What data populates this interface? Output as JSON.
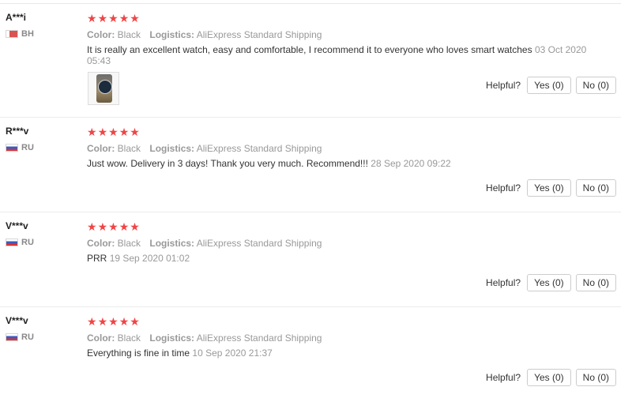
{
  "reviews": [
    {
      "user": "A***i",
      "country": "BH",
      "rating": 5,
      "color_label": "Color:",
      "color_value": "Black",
      "logistics_label": "Logistics:",
      "logistics_value": "AliExpress Standard Shipping",
      "text": "It is really an excellent watch, easy and comfortable, I recommend it to everyone who loves smart watches",
      "date": "03 Oct 2020 05:43",
      "helpful_label": "Helpful?",
      "yes_label": "Yes (0)",
      "no_label": "No (0)"
    },
    {
      "user": "R***v",
      "country": "RU",
      "rating": 5,
      "color_label": "Color:",
      "color_value": "Black",
      "logistics_label": "Logistics:",
      "logistics_value": "AliExpress Standard Shipping",
      "text": "Just wow. Delivery in 3 days! Thank you very much. Recommend!!!",
      "date": "28 Sep 2020 09:22",
      "helpful_label": "Helpful?",
      "yes_label": "Yes (0)",
      "no_label": "No (0)"
    },
    {
      "user": "V***v",
      "country": "RU",
      "rating": 5,
      "color_label": "Color:",
      "color_value": "Black",
      "logistics_label": "Logistics:",
      "logistics_value": "AliExpress Standard Shipping",
      "text": "PRR",
      "date": "19 Sep 2020 01:02",
      "helpful_label": "Helpful?",
      "yes_label": "Yes (0)",
      "no_label": "No (0)"
    },
    {
      "user": "V***v",
      "country": "RU",
      "rating": 5,
      "color_label": "Color:",
      "color_value": "Black",
      "logistics_label": "Logistics:",
      "logistics_value": "AliExpress Standard Shipping",
      "text": "Everything is fine in time",
      "date": "10 Sep 2020 21:37",
      "helpful_label": "Helpful?",
      "yes_label": "Yes (0)",
      "no_label": "No (0)"
    }
  ],
  "star_color": "#f04545",
  "star_icon": "star-icon"
}
